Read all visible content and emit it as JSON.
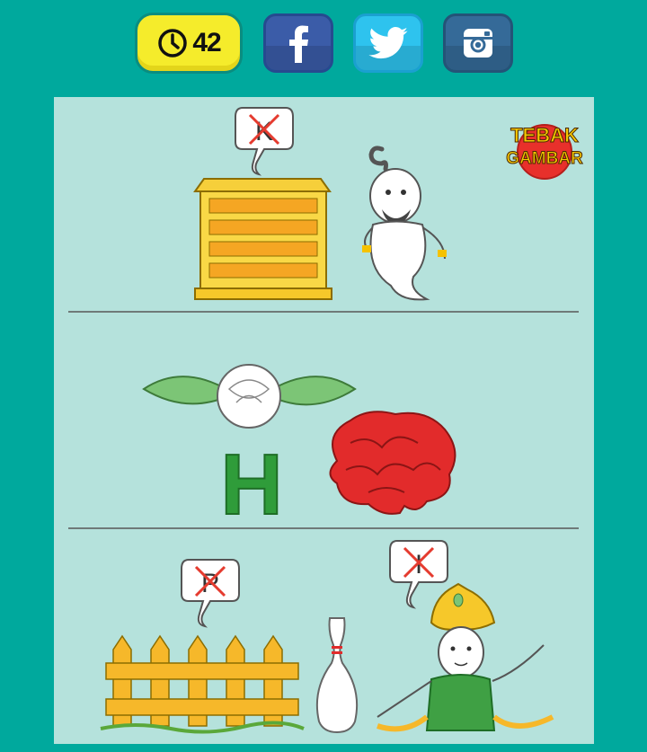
{
  "timer": {
    "value": "42",
    "icon": "clock-icon"
  },
  "social": [
    {
      "name": "facebook",
      "icon": "facebook-icon",
      "color": "#3b5ca8"
    },
    {
      "name": "twitter",
      "icon": "twitter-icon",
      "color": "#2ec3ee"
    },
    {
      "name": "instagram",
      "icon": "instagram-icon",
      "color": "#356a98"
    }
  ],
  "logo": {
    "line1": "TEBAK",
    "line2": "GAMBAR"
  },
  "puzzle": {
    "row1": {
      "bubble_letter": "K"
    },
    "row2": {
      "letter": "H"
    },
    "row3": {
      "bubble_left": "P",
      "bubble_right": "I"
    }
  },
  "colors": {
    "background": "#00a99d",
    "board": "#b5e2dc",
    "timer": "#f5ec2b"
  }
}
